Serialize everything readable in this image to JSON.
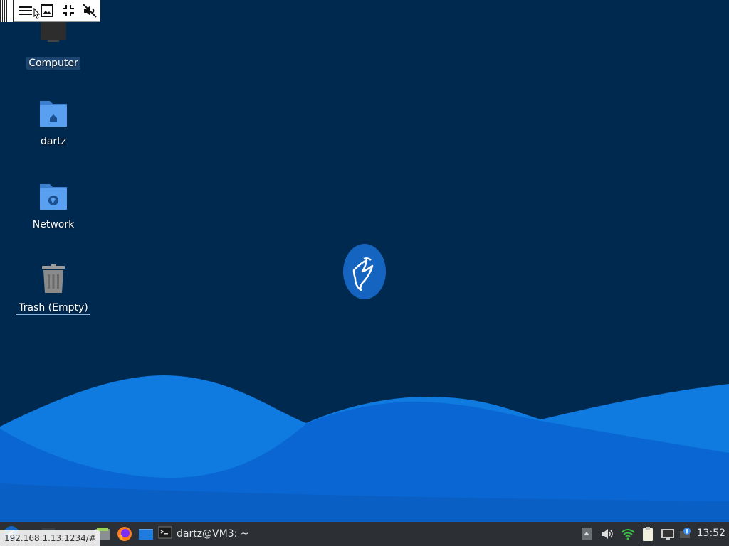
{
  "desktop": {
    "icons": [
      {
        "label": "Computer"
      },
      {
        "label": "dartz"
      },
      {
        "label": "Network"
      },
      {
        "label": "Trash (Empty)"
      }
    ]
  },
  "vnc_toolbar": {
    "buttons": [
      "menu-icon",
      "image-icon",
      "fullscreen-exit-icon",
      "mute-icon"
    ]
  },
  "taskbar": {
    "task_terminal": "dartz@VM3: ~",
    "tray_icons": [
      "panel-up-icon",
      "volume-icon",
      "wifi-icon",
      "clipboard-icon",
      "display-icon",
      "notification-icon"
    ],
    "clock": "13:52"
  },
  "status_url": "192.168.1.13:1234/#",
  "colors": {
    "desktop_bg": "#00294f",
    "wave_light": "#1e88e5",
    "wave_dark": "#0a62c8",
    "taskbar_bg": "#2c3034"
  }
}
